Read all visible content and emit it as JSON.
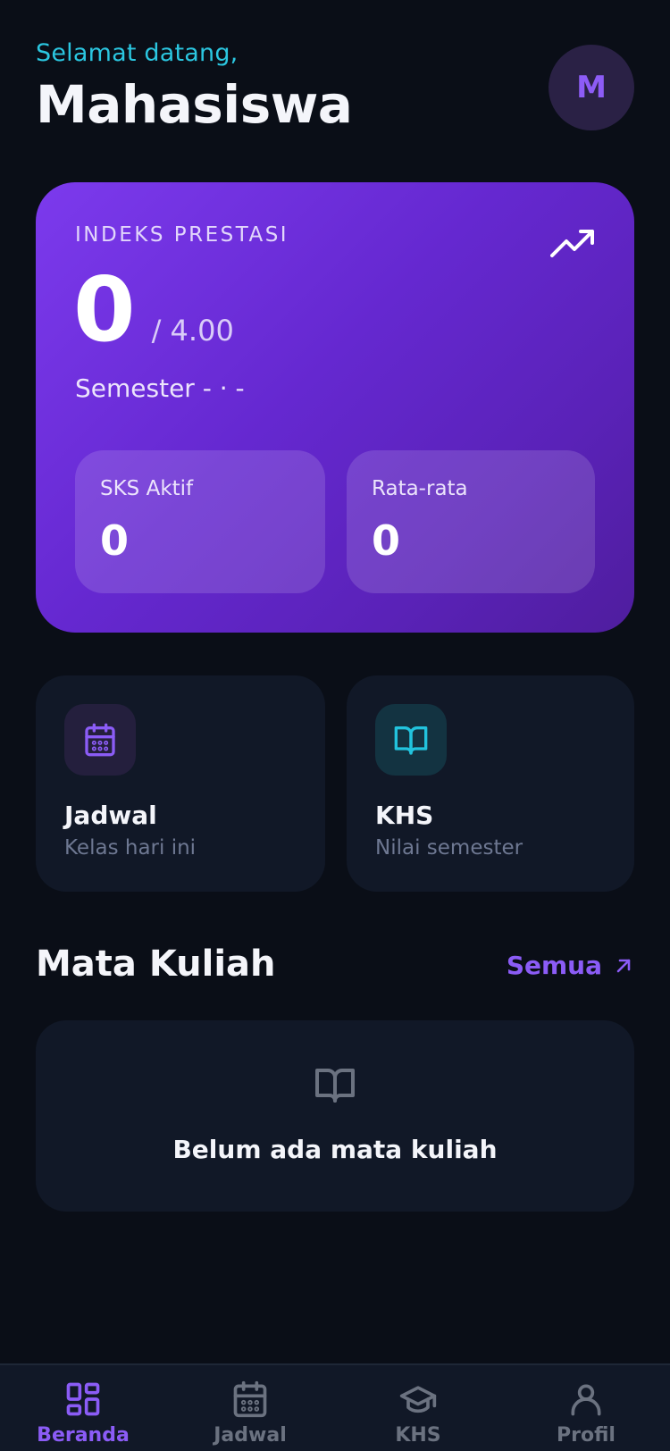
{
  "header": {
    "greeting": "Selamat datang,",
    "name": "Mahasiswa",
    "avatar_initial": "M"
  },
  "ipk_card": {
    "label": "INDEKS PRESTASI",
    "value": "0",
    "max": "/ 4.00",
    "semester": "Semester - · -",
    "trend_icon": "trending-up-icon",
    "stats": [
      {
        "label": "SKS Aktif",
        "value": "0"
      },
      {
        "label": "Rata-rata",
        "value": "0"
      }
    ]
  },
  "features": [
    {
      "title": "Jadwal",
      "subtitle": "Kelas hari ini",
      "icon": "calendar-icon",
      "accent": "#8b5cf6"
    },
    {
      "title": "KHS",
      "subtitle": "Nilai semester",
      "icon": "book-open-icon",
      "accent": "#22c3dd"
    }
  ],
  "courses_section": {
    "title": "Mata Kuliah",
    "see_all": "Semua",
    "empty_text": "Belum ada mata kuliah"
  },
  "bottom_nav": {
    "items": [
      {
        "label": "Beranda",
        "icon": "dashboard-grid-icon",
        "active": true
      },
      {
        "label": "Jadwal",
        "icon": "calendar-icon",
        "active": false
      },
      {
        "label": "KHS",
        "icon": "graduation-cap-icon",
        "active": false
      },
      {
        "label": "Profil",
        "icon": "user-icon",
        "active": false
      }
    ]
  },
  "colors": {
    "background": "#0a0e17",
    "card": "#111827",
    "accent": "#8b5cf6",
    "cyan": "#2bc6e0"
  }
}
